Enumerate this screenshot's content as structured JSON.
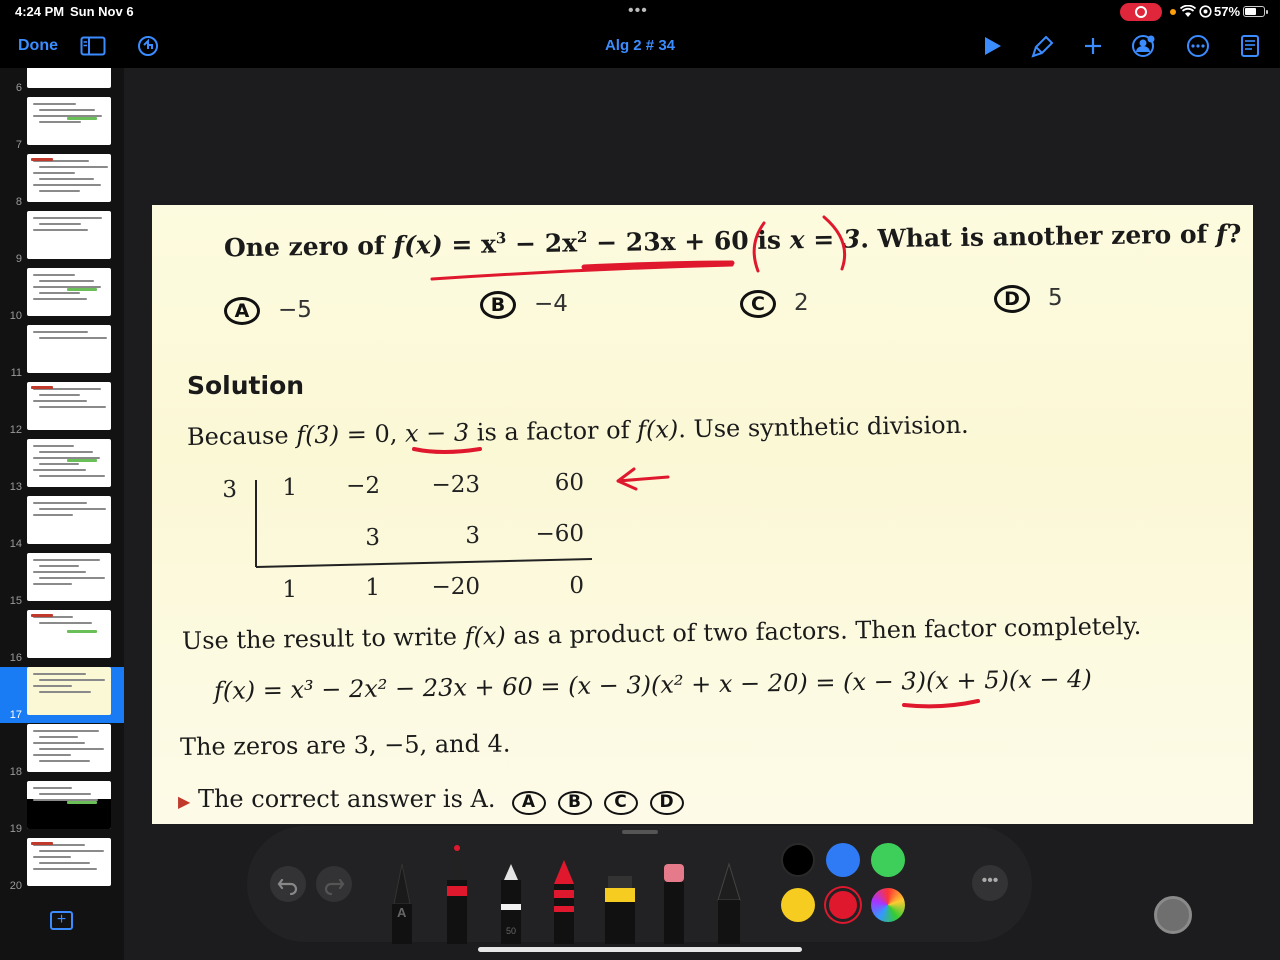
{
  "status": {
    "time": "4:24 PM",
    "date": "Sun Nov 6",
    "battery": "57%"
  },
  "toolbar": {
    "done": "Done",
    "title": "Alg 2 # 34"
  },
  "sidebar": {
    "slides": [
      {
        "n": "6"
      },
      {
        "n": "7"
      },
      {
        "n": "8"
      },
      {
        "n": "9"
      },
      {
        "n": "10"
      },
      {
        "n": "11"
      },
      {
        "n": "12"
      },
      {
        "n": "13"
      },
      {
        "n": "14"
      },
      {
        "n": "15"
      },
      {
        "n": "16"
      },
      {
        "n": "17"
      },
      {
        "n": "18"
      },
      {
        "n": "19"
      },
      {
        "n": "20"
      }
    ],
    "selected": "17",
    "add_label": "+"
  },
  "slide": {
    "question": {
      "lead": "One zero of ",
      "fx": "f(x)",
      "eq": " = x",
      "pow3": "3",
      "mid": " − 2x",
      "pow2": "2",
      "tail": " − 23x + 60 is ",
      "root": "x = 3",
      "end": ". What is another zero of ",
      "f": "f",
      "q": "?"
    },
    "choices": [
      {
        "letter": "A",
        "value": "−5"
      },
      {
        "letter": "B",
        "value": "−4"
      },
      {
        "letter": "C",
        "value": "2"
      },
      {
        "letter": "D",
        "value": "5"
      }
    ],
    "solution_heading": "Solution",
    "because": {
      "a": "Because ",
      "f3": "f(3)",
      "b": " = 0, ",
      "factor": "x − 3",
      "c": " is a factor of ",
      "fx": "f(x)",
      "d": ". Use synthetic division."
    },
    "synthetic": {
      "divisor": "3",
      "row1": [
        "1",
        "−2",
        "−23",
        "60"
      ],
      "row2": [
        "3",
        "3",
        "−60"
      ],
      "row3": [
        "1",
        "1",
        "−20",
        "0"
      ]
    },
    "use_result": {
      "a": "Use the result to write ",
      "fx": "f(x)",
      "b": " as a product of two factors. Then factor completely."
    },
    "factored": "f(x) = x³ − 2x² − 23x + 60 = (x − 3)(x² + x − 20) = (x − 3)(x + 5)(x − 4)",
    "zeros": "The zeros are 3, −5, and 4.",
    "answer": {
      "text": "The correct answer is A.",
      "badges": [
        "A",
        "B",
        "C",
        "D"
      ]
    }
  },
  "tray": {
    "marker_width": "50",
    "pencil_label": "A"
  },
  "colors": {
    "accent": "#3a8cff",
    "annotation_red": "#e0182d",
    "swatches": [
      "#000000",
      "#2f7bf5",
      "#3ecf5a",
      "#f5cc1f",
      "#e0182d",
      "multicolor"
    ]
  }
}
